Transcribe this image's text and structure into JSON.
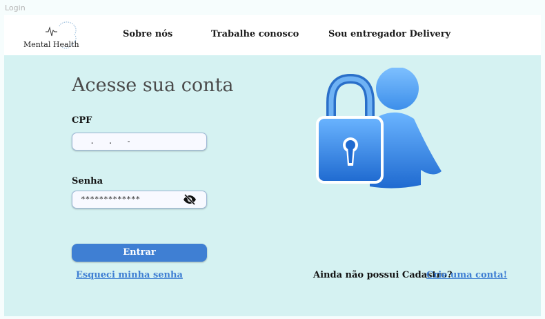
{
  "page": {
    "label": "Login"
  },
  "header": {
    "logo_text": "Mental Health",
    "nav": [
      {
        "label": "Sobre nós"
      },
      {
        "label": "Trabalhe conosco"
      },
      {
        "label": "Sou entregador Delivery"
      }
    ]
  },
  "login": {
    "title": "Acesse sua conta",
    "cpf_label": "CPF",
    "cpf_value": "  .   .   -",
    "password_label": "Senha",
    "password_value": "*************",
    "submit_label": "Entrar",
    "forgot_label": "Esqueci minha senha"
  },
  "signup": {
    "question": "Ainda não possui Cadastro?",
    "link_label": "Crie uma conta!"
  },
  "colors": {
    "accent": "#3f7fd3",
    "panel_bg": "#d5f2f2",
    "header_bg": "#ffffff"
  },
  "icons": {
    "password_toggle": "eye-off-icon",
    "illustration": "lock-user-icon"
  }
}
